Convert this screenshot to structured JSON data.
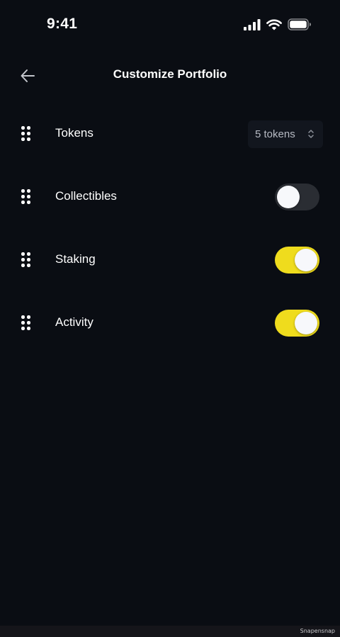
{
  "status_bar": {
    "time": "9:41"
  },
  "header": {
    "title": "Customize Portfolio",
    "back_icon": "arrow-left-icon"
  },
  "rows": [
    {
      "label": "Tokens",
      "control": "select",
      "value": "5 tokens"
    },
    {
      "label": "Collectibles",
      "control": "toggle",
      "enabled": false
    },
    {
      "label": "Staking",
      "control": "toggle",
      "enabled": true
    },
    {
      "label": "Activity",
      "control": "toggle",
      "enabled": true
    }
  ],
  "colors": {
    "background": "#0a0d13",
    "toggle_on": "#efdc1d",
    "toggle_off": "#2a2d33",
    "select_background": "#12161e"
  },
  "footer": {
    "watermark": "Snapensnap"
  }
}
